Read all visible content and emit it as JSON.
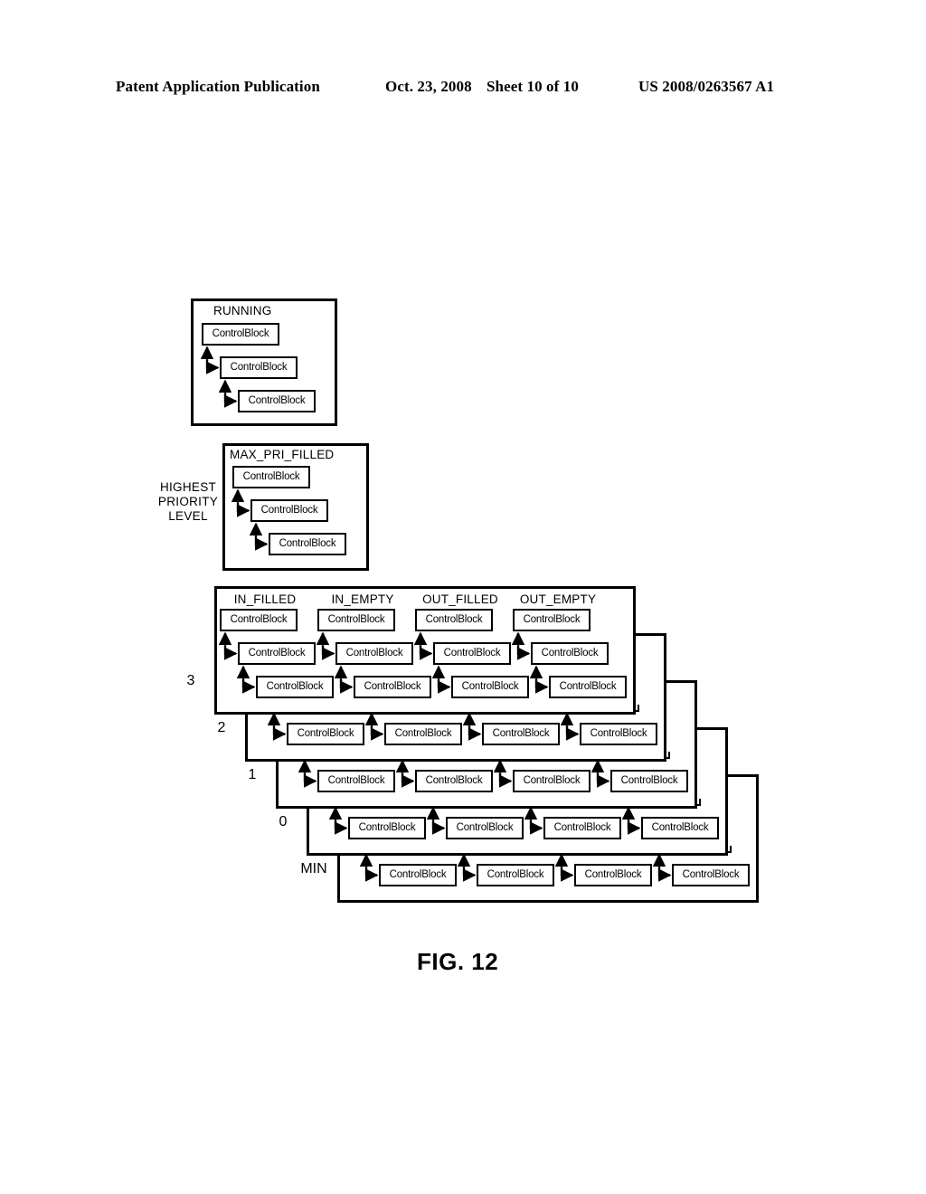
{
  "header": {
    "publication": "Patent Application Publication",
    "date": "Oct. 23, 2008",
    "sheet": "Sheet 10 of 10",
    "number": "US 2008/0263567 A1"
  },
  "figure": {
    "caption": "FIG. 12",
    "block_label": "ControlBlock",
    "running_panel": {
      "title": "RUNNING",
      "blocks": [
        "ControlBlock",
        "ControlBlock",
        "ControlBlock"
      ]
    },
    "max_pri_panel": {
      "title": "MAX_PRI_FILLED",
      "side_label_lines": [
        "HIGHEST",
        "PRIORITY",
        "LEVEL"
      ],
      "blocks": [
        "ControlBlock",
        "ControlBlock",
        "ControlBlock"
      ]
    },
    "queue_stack": {
      "columns": [
        "IN_FILLED",
        "IN_EMPTY",
        "OUT_FILLED",
        "OUT_EMPTY"
      ],
      "levels": [
        "3",
        "2",
        "1",
        "0",
        "MIN"
      ],
      "blocks_per_column": 3,
      "front_level": "3"
    }
  }
}
